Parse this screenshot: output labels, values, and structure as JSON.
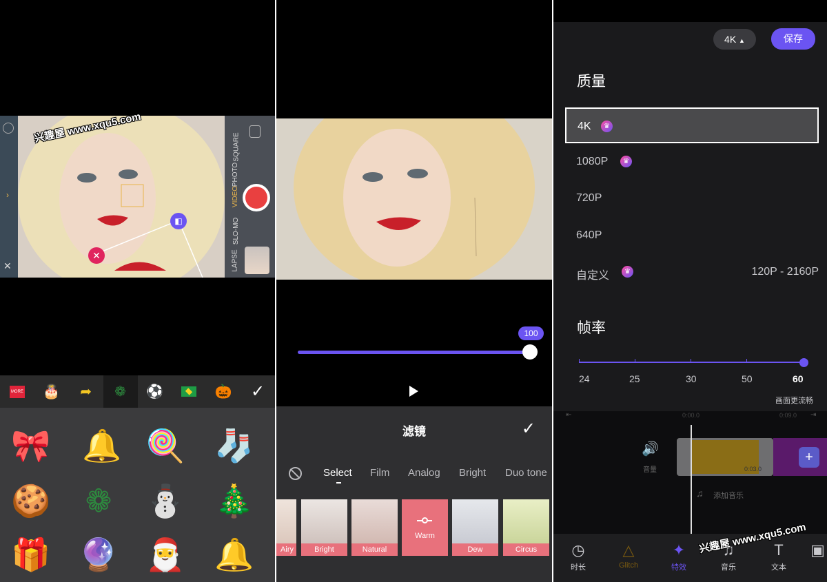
{
  "panel1": {
    "watermark": "兴趣屋 www.xqu5.com",
    "camera_modes": [
      "SQUARE",
      "PHOTO",
      "VIDEO",
      "SLO-MO",
      "LAPSE"
    ],
    "active_mode": "VIDEO",
    "sticker_tabs": [
      "more-tab-icon",
      "cake-icon",
      "arrow-icon",
      "wreath-icon",
      "soccer-icon",
      "flag-icon",
      "pumpkin-icon"
    ],
    "confirm_icon": "checkmark-icon",
    "stickers": [
      "bow",
      "bell",
      "candy-cane",
      "stocking",
      "gingerbread",
      "wreath",
      "snowman",
      "christmas-tree",
      "gift-bag",
      "snow-globe",
      "santa",
      "bells"
    ]
  },
  "panel2": {
    "intensity": "100",
    "title": "滤镜",
    "tabs": [
      "Select",
      "Film",
      "Analog",
      "Bright",
      "Duo tone"
    ],
    "active_tab": "Select",
    "filters": [
      "Airy",
      "Bright",
      "Natural",
      "Warm",
      "Dew",
      "Circus"
    ],
    "selected_filter": "Warm"
  },
  "panel3": {
    "resolution_pill": "4K",
    "save": "保存",
    "quality_title": "质量",
    "quality_options": [
      {
        "label": "4K",
        "pro": true,
        "range": ""
      },
      {
        "label": "1080P",
        "pro": true,
        "range": ""
      },
      {
        "label": "720P",
        "pro": false,
        "range": ""
      },
      {
        "label": "640P",
        "pro": false,
        "range": ""
      },
      {
        "label": "自定义",
        "pro": true,
        "range": "120P - 2160P"
      }
    ],
    "selected_quality": "4K",
    "fps_title": "帧率",
    "fps_values": [
      "24",
      "25",
      "30",
      "50",
      "60"
    ],
    "selected_fps": "60",
    "fps_hint": "画面更流畅",
    "timeline": {
      "start": "0:00.0",
      "mark": "0:09.0",
      "clip_duration": "0:03.0",
      "volume_label": "音量",
      "add_music": "添加音乐"
    },
    "nav": [
      "时长",
      "Glitch",
      "特效",
      "音乐",
      "文本"
    ],
    "active_nav": "特效",
    "watermark": "兴趣屋 www.xqu5.com"
  }
}
